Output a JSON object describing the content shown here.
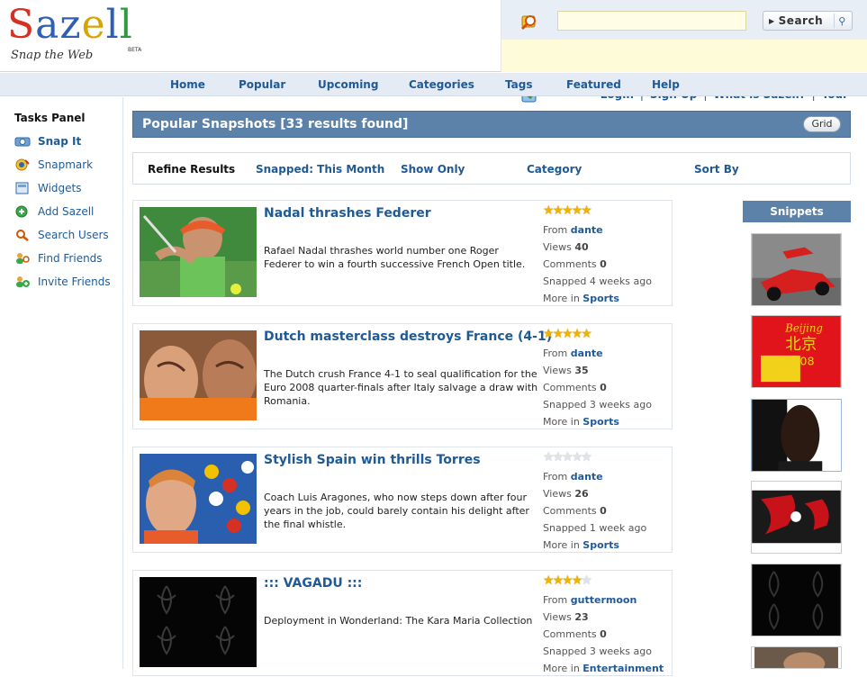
{
  "brand": {
    "name_letters": [
      "S",
      "a",
      "z",
      "e",
      "l",
      "l"
    ],
    "letter_colors": [
      "#d63025",
      "#2f5fb5",
      "#2f5fb5",
      "#d9a400",
      "#2f5fb5",
      "#2e9a3b"
    ],
    "beta": "BETA",
    "tagline": "Snap the Web"
  },
  "search": {
    "placeholder": "",
    "button_label": "Search"
  },
  "toplinks": {
    "login": "Login",
    "signup": "Sign Up",
    "what": "What is Sazell?",
    "tour": "Tour",
    "sep": "|"
  },
  "nav": {
    "items": [
      "Home",
      "Popular",
      "Upcoming",
      "Categories",
      "Tags",
      "Featured",
      "Help"
    ]
  },
  "tasks": {
    "title": "Tasks Panel",
    "items": [
      {
        "label": "Snap It",
        "icon": "camera-icon"
      },
      {
        "label": "Snapmark",
        "icon": "snapmark-icon"
      },
      {
        "label": "Widgets",
        "icon": "widget-icon"
      },
      {
        "label": "Add Sazell",
        "icon": "add-icon"
      },
      {
        "label": "Search Users",
        "icon": "search-users-icon"
      },
      {
        "label": "Find Friends",
        "icon": "find-friends-icon"
      },
      {
        "label": "Invite Friends",
        "icon": "invite-friends-icon"
      }
    ]
  },
  "main": {
    "title": "Popular Snapshots [33 results found]",
    "grid_label": "Grid"
  },
  "refine": {
    "label": "Refine Results",
    "snapped": "Snapped: This Month",
    "show_only": "Show Only",
    "category": "Category",
    "sort_by": "Sort By"
  },
  "snapshots": [
    {
      "title": "Nadal thrashes Federer",
      "desc": "Rafael Nadal thrashes world number one Roger Federer to win a fourth successive French Open title.",
      "rating": 5,
      "from_label": "From",
      "user": "dante",
      "views_label": "Views",
      "views": "40",
      "comments_label": "Comments",
      "comments": "0",
      "snapped": "Snapped 4 weeks ago",
      "more_label": "More in",
      "category": "Sports"
    },
    {
      "title": "Dutch masterclass destroys France (4-1)",
      "desc": "The Dutch crush France 4-1 to seal qualification for the Euro 2008 quarter-finals after Italy salvage a draw with Romania.",
      "rating": 5,
      "from_label": "From",
      "user": "dante",
      "views_label": "Views",
      "views": "35",
      "comments_label": "Comments",
      "comments": "0",
      "snapped": "Snapped 3 weeks ago",
      "more_label": "More in",
      "category": "Sports"
    },
    {
      "title": "Stylish Spain win thrills Torres",
      "desc": "Coach Luis Aragones, who now steps down after four years in the job, could barely contain his delight after the final whistle.",
      "rating": 0,
      "from_label": "From",
      "user": "dante",
      "views_label": "Views",
      "views": "26",
      "comments_label": "Comments",
      "comments": "0",
      "snapped": "Snapped 1 week ago",
      "more_label": "More in",
      "category": "Sports"
    },
    {
      "title": "::: VAGADU :::",
      "desc": "Deployment in Wonderland: The Kara Maria Collection",
      "rating": 4,
      "from_label": "From",
      "user": "guttermoon",
      "views_label": "Views",
      "views": "23",
      "comments_label": "Comments",
      "comments": "0",
      "snapped": "Snapped 3 weeks ago",
      "more_label": "More in",
      "category": "Entertainment"
    }
  ],
  "snippets": {
    "title": "Snippets",
    "beijing_line1": "Beijing",
    "beijing_line2": "北京",
    "beijing_line3": "2008"
  }
}
